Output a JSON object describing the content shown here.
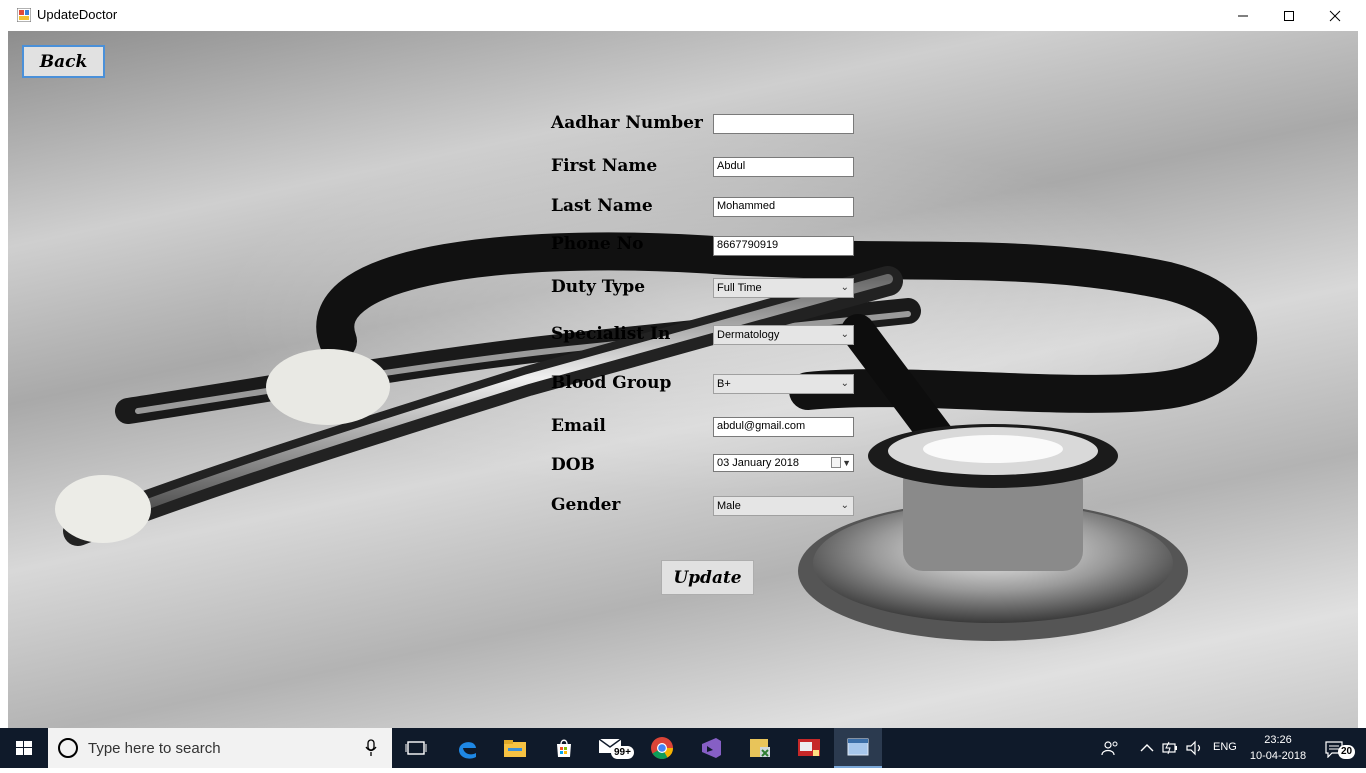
{
  "window": {
    "title": "UpdateDoctor",
    "controls": {
      "minimize": "minimize",
      "maximize": "maximize",
      "close": "close"
    }
  },
  "buttons": {
    "back_label": "Back",
    "update_label": "Update"
  },
  "form": {
    "aadhar": {
      "label": "Aadhar Number",
      "value": ""
    },
    "first_name": {
      "label": "First Name",
      "value": "Abdul"
    },
    "last_name": {
      "label": "Last Name",
      "value": "Mohammed"
    },
    "phone": {
      "label": "Phone No",
      "value": "8667790919"
    },
    "duty_type": {
      "label": "Duty Type",
      "value": "Full Time"
    },
    "specialist": {
      "label": "Specialist In",
      "value": "Dermatology"
    },
    "blood_group": {
      "label": "Blood Group",
      "value": "B+"
    },
    "email": {
      "label": "Email",
      "value": "abdul@gmail.com"
    },
    "dob": {
      "label": "DOB",
      "value": "03   January   2018"
    },
    "gender": {
      "label": "Gender",
      "value": "Male"
    }
  },
  "taskbar": {
    "search_placeholder": "Type here to search",
    "mail_badge": "99+",
    "language": "ENG",
    "time": "23:26",
    "date": "10-04-2018",
    "notification_count": "20",
    "pinned": [
      "task-view-icon",
      "edge-icon",
      "file-explorer-icon",
      "store-icon",
      "mail-icon",
      "chrome-icon",
      "visual-studio-icon",
      "database-tool-icon",
      "app-icon",
      "window-app-icon"
    ]
  }
}
